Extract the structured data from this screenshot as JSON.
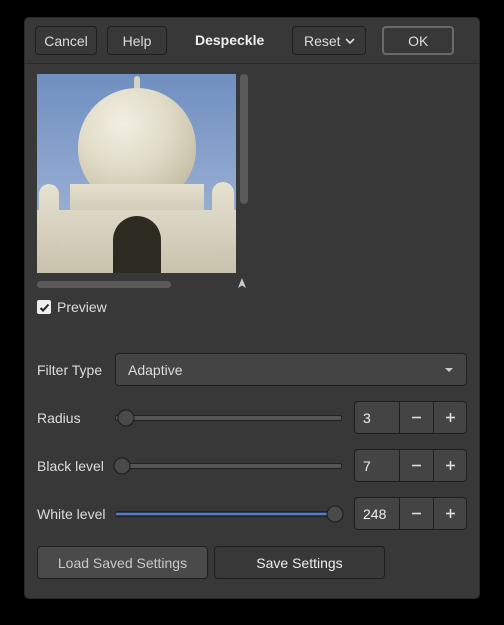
{
  "topbar": {
    "cancel": "Cancel",
    "help": "Help",
    "title": "Despeckle",
    "reset": "Reset",
    "ok": "OK"
  },
  "preview": {
    "checkbox_label": "Preview",
    "checked": true
  },
  "filter_type": {
    "label": "Filter Type",
    "value": "Adaptive"
  },
  "radius": {
    "label": "Radius",
    "value": "3",
    "min": 1,
    "max": 100,
    "pos_pct": 5
  },
  "black_level": {
    "label": "Black level",
    "value": "7",
    "min": 0,
    "max": 255,
    "pos_pct": 3
  },
  "white_level": {
    "label": "White level",
    "value": "248",
    "min": 0,
    "max": 255,
    "pos_pct": 97
  },
  "bottom": {
    "load": "Load Saved Settings",
    "save": "Save Settings"
  }
}
